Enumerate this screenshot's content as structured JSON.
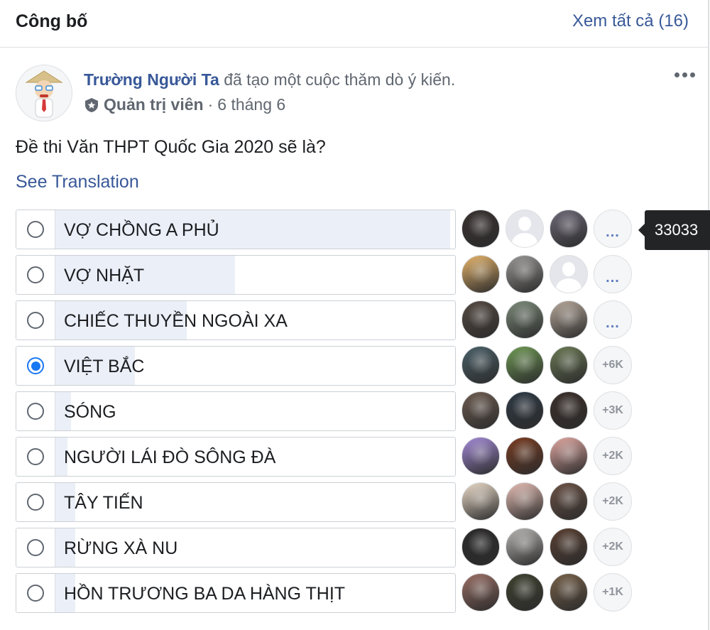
{
  "header": {
    "title": "Công bố",
    "see_all": "Xem tất cả (16)"
  },
  "post": {
    "author": "Trường Người Ta",
    "action": "đã tạo một cuộc thăm dò ý kiến.",
    "role": "Quản trị viên",
    "separator": "·",
    "date": "6 tháng 6",
    "question": "Đề thi Văn THPT Quốc Gia 2020 sẽ là?",
    "see_translation": "See Translation",
    "icons": {
      "more": "more-horizontal-icon",
      "admin": "shield-star-icon"
    }
  },
  "poll": {
    "options": [
      {
        "label": "VỢ CHỒNG A PHỦ",
        "checked": false,
        "share": 0.99,
        "more": "...",
        "avatars": [
          "#3a3230",
          "default",
          "#6e6a78"
        ]
      },
      {
        "label": "VỢ NHẶT",
        "checked": false,
        "share": 0.45,
        "more": "...",
        "avatars": [
          "#e6b46a",
          "#9a9896",
          "default"
        ]
      },
      {
        "label": "CHIẾC THUYỀN NGOÀI XA",
        "checked": false,
        "share": 0.33,
        "more": "...",
        "avatars": [
          "#564a42",
          "#7d8b7a",
          "#b7a89a"
        ]
      },
      {
        "label": "VIỆT BẮC",
        "checked": true,
        "share": 0.2,
        "more": "+6K",
        "avatars": [
          "#4b6069",
          "#6f9a55",
          "#6b7a55"
        ]
      },
      {
        "label": "SÓNG",
        "checked": false,
        "share": 0.04,
        "more": "+3K",
        "avatars": [
          "#6f5d52",
          "#2f3a46",
          "#3b2f2a"
        ]
      },
      {
        "label": "NGƯỜI LÁI ĐÒ SÔNG ĐÀ",
        "checked": false,
        "share": 0.03,
        "more": "+2K",
        "avatars": [
          "#a48bd8",
          "#7a3d22",
          "#e2a8a2"
        ]
      },
      {
        "label": "TÂY TIẾN",
        "checked": false,
        "share": 0.05,
        "more": "+2K",
        "avatars": [
          "#ecdcc9",
          "#e7bfb5",
          "#6c5246"
        ]
      },
      {
        "label": "RỪNG XÀ NU",
        "checked": false,
        "share": 0.05,
        "more": "+2K",
        "avatars": [
          "#2d2b2b",
          "#b8b6b2",
          "#5a4032"
        ]
      },
      {
        "label": "HỒN TRƯƠNG BA DA HÀNG THỊT",
        "checked": false,
        "share": 0.05,
        "more": "+1K",
        "avatars": [
          "#9b7066",
          "#3f4230",
          "#78624a"
        ]
      }
    ]
  },
  "tooltip": {
    "text": "33033"
  }
}
